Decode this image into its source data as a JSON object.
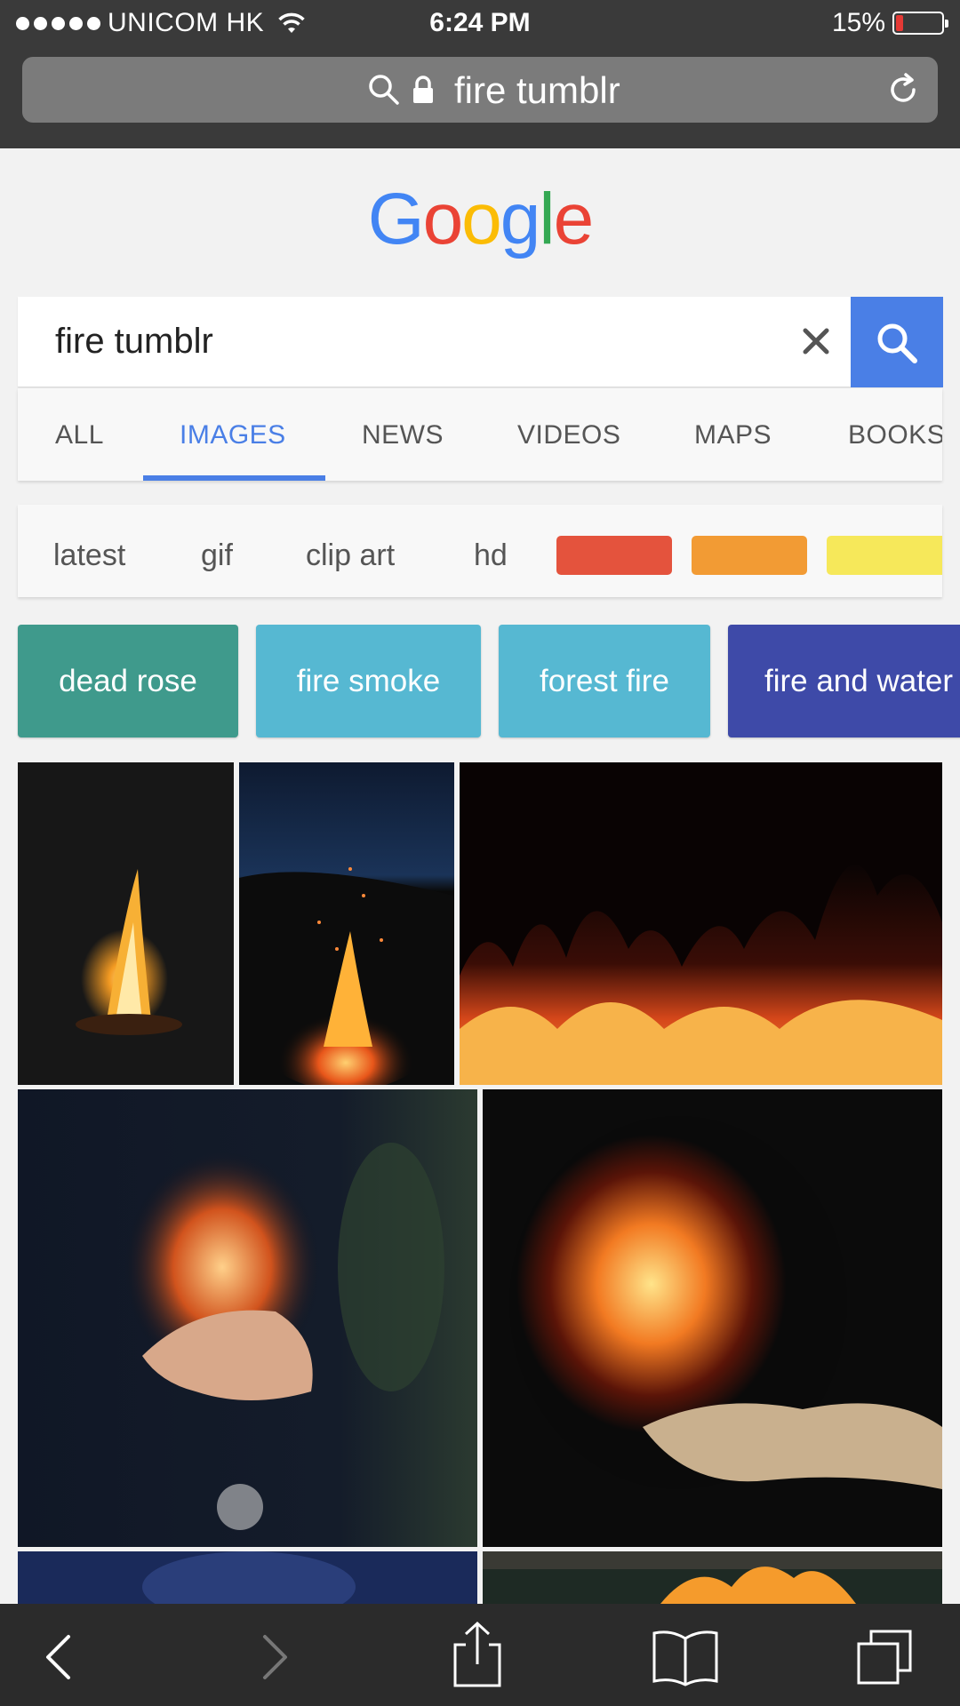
{
  "status": {
    "carrier": "UNICOM HK",
    "time": "6:24 PM",
    "battery": "15%",
    "battery_level": 0.15
  },
  "url_bar": {
    "text": "fire tumblr"
  },
  "logo": {
    "letters": [
      "G",
      "o",
      "o",
      "g",
      "l",
      "e"
    ],
    "colors": [
      "#4285f4",
      "#ea4335",
      "#fbbc05",
      "#4285f4",
      "#34a853",
      "#ea4335"
    ]
  },
  "search": {
    "query": "fire tumblr"
  },
  "tabs": [
    {
      "label": "ALL",
      "active": false
    },
    {
      "label": "IMAGES",
      "active": true
    },
    {
      "label": "NEWS",
      "active": false
    },
    {
      "label": "VIDEOS",
      "active": false
    },
    {
      "label": "MAPS",
      "active": false
    },
    {
      "label": "BOOKS",
      "active": false
    }
  ],
  "filters": {
    "chips": [
      "latest",
      "gif",
      "clip art",
      "hd"
    ],
    "color_swatches": [
      "#e4533d",
      "#f29b34",
      "#f6e85a"
    ]
  },
  "related": [
    {
      "label": "dead rose",
      "color": "#3f9a8c"
    },
    {
      "label": "fire smoke",
      "color": "#56b8d2"
    },
    {
      "label": "forest fire",
      "color": "#56b8d2"
    },
    {
      "label": "fire and water",
      "color": "#3e4aa8"
    }
  ],
  "toolbar": {
    "icons": [
      "back-icon",
      "forward-icon",
      "share-icon",
      "bookmarks-icon",
      "tabs-icon"
    ]
  }
}
